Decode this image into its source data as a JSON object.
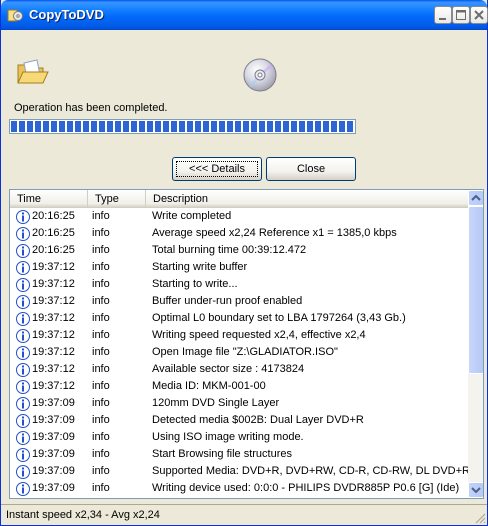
{
  "window": {
    "title": "CopyToDVD"
  },
  "main": {
    "status_message": "Operation has been completed.",
    "progress_fraction": 1.0,
    "details_label": "<<< Details",
    "close_label": "Close"
  },
  "log": {
    "columns": [
      "Time",
      "Type",
      "Description"
    ],
    "rows": [
      {
        "time": "20:16:25",
        "type": "info",
        "desc": "Write completed"
      },
      {
        "time": "20:16:25",
        "type": "info",
        "desc": "Average speed x2,24 Reference x1 = 1385,0 kbps"
      },
      {
        "time": "20:16:25",
        "type": "info",
        "desc": "Total burning time 00:39:12.472"
      },
      {
        "time": "19:37:12",
        "type": "info",
        "desc": "Starting write buffer"
      },
      {
        "time": "19:37:12",
        "type": "info",
        "desc": "Starting to write..."
      },
      {
        "time": "19:37:12",
        "type": "info",
        "desc": "Buffer under-run proof enabled"
      },
      {
        "time": "19:37:12",
        "type": "info",
        "desc": "Optimal L0 boundary set to LBA 1797264 (3,43 Gb.)"
      },
      {
        "time": "19:37:12",
        "type": "info",
        "desc": "Writing speed requested x2,4, effective x2,4"
      },
      {
        "time": "19:37:12",
        "type": "info",
        "desc": "Open Image file \"Z:\\GLADIATOR.ISO\""
      },
      {
        "time": "19:37:12",
        "type": "info",
        "desc": "Available sector size : 4173824"
      },
      {
        "time": "19:37:12",
        "type": "info",
        "desc": "Media ID: MKM-001-00"
      },
      {
        "time": "19:37:09",
        "type": "info",
        "desc": "120mm DVD Single Layer"
      },
      {
        "time": "19:37:09",
        "type": "info",
        "desc": "Detected media $002B: Dual Layer DVD+R"
      },
      {
        "time": "19:37:09",
        "type": "info",
        "desc": "Using ISO image writing mode."
      },
      {
        "time": "19:37:09",
        "type": "info",
        "desc": "Start Browsing file structures"
      },
      {
        "time": "19:37:09",
        "type": "info",
        "desc": "Supported Media: DVD+R, DVD+RW, CD-R, CD-RW, DL DVD+R"
      },
      {
        "time": "19:37:09",
        "type": "info",
        "desc": "Writing device used: 0:0:0 - PHILIPS DVDR885P P0.6 [G] (Ide)"
      }
    ]
  },
  "statusbar": {
    "text": "Instant speed x2,34 - Avg x2,24"
  },
  "icons": {
    "app": "app-icon",
    "folder": "open-folder-icon",
    "disc": "dvd-disc-icon",
    "row": "info-icon"
  },
  "colors": {
    "titlebar": "#0058ee",
    "progress": "#2d65d4",
    "info_icon": "#2451c8"
  }
}
